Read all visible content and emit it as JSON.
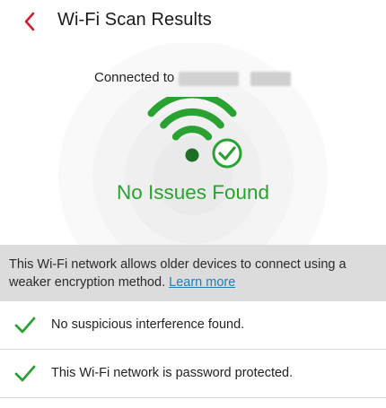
{
  "header": {
    "title": "Wi-Fi Scan Results",
    "back_icon": "chevron-left-icon",
    "back_color": "#d0202d"
  },
  "hero": {
    "connected_label": "Connected to",
    "wifi_icon": "wifi-icon",
    "status_icon": "check-circle-icon",
    "status_title": "No Issues Found",
    "status_color": "#2aa232"
  },
  "notice": {
    "text": "This Wi-Fi network allows older devices to connect using a weaker encryption method. ",
    "link_label": "Learn more",
    "link_color": "#1e7fb8"
  },
  "results": [
    {
      "icon": "check-icon",
      "text": "No suspicious interference found."
    },
    {
      "icon": "check-icon",
      "text": "This Wi-Fi network is password protected."
    }
  ]
}
